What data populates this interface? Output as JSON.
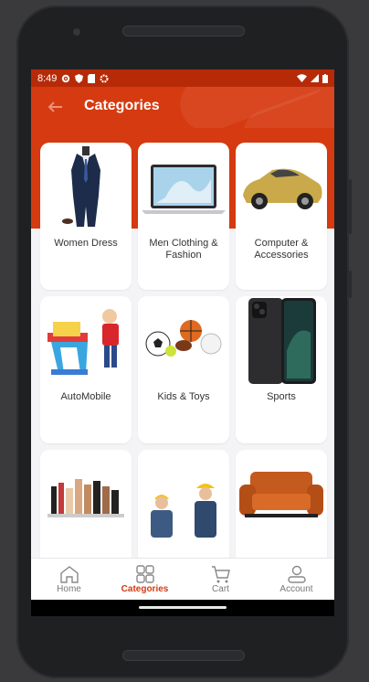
{
  "status": {
    "time": "8:49"
  },
  "appbar": {
    "title": "Categories"
  },
  "categories": [
    {
      "label": "Women Dress",
      "image": "suit-image"
    },
    {
      "label": "Men Clothing & Fashion",
      "image": "laptop-image"
    },
    {
      "label": "Computer & Accessories",
      "image": "car-image"
    },
    {
      "label": "AutoMobile",
      "image": "kid-easel-image"
    },
    {
      "label": "Kids & Toys",
      "image": "sports-balls-image"
    },
    {
      "label": "Sports",
      "image": "smartphone-image"
    },
    {
      "label": "",
      "image": "cosmetics-image"
    },
    {
      "label": "",
      "image": "workers-image"
    },
    {
      "label": "",
      "image": "sofa-image"
    }
  ],
  "nav": {
    "items": [
      {
        "label": "Home",
        "icon": "home-icon"
      },
      {
        "label": "Categories",
        "icon": "grid-icon"
      },
      {
        "label": "Cart",
        "icon": "cart-icon"
      },
      {
        "label": "Account",
        "icon": "user-icon"
      }
    ],
    "active": "Categories"
  },
  "colors": {
    "brand": "#d53a10",
    "statusbar": "#b72a08",
    "background": "#f4f4f6"
  }
}
